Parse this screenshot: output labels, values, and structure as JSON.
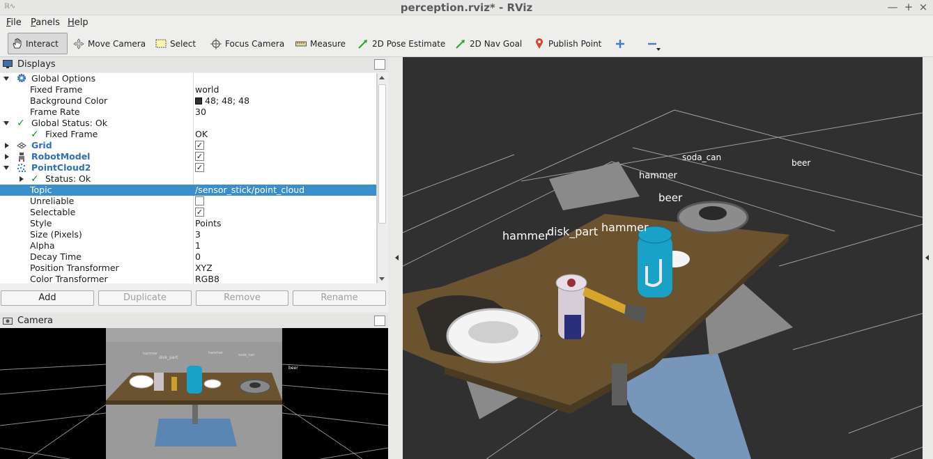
{
  "window": {
    "title": "perception.rviz* - RViz",
    "controls": [
      "—",
      "+",
      "×"
    ]
  },
  "menu": [
    "File",
    "Panels",
    "Help"
  ],
  "toolbar": {
    "interact": "Interact",
    "move_camera": "Move Camera",
    "select": "Select",
    "focus_camera": "Focus Camera",
    "measure": "Measure",
    "pose_estimate": "2D Pose Estimate",
    "nav_goal": "2D Nav Goal",
    "publish_point": "Publish Point"
  },
  "displays": {
    "title": "Displays",
    "rows": {
      "global_options": "Global Options",
      "fixed_frame_label": "Fixed Frame",
      "fixed_frame_value": "world",
      "bg_color_label": "Background Color",
      "bg_color_value": "48; 48; 48",
      "frame_rate_label": "Frame Rate",
      "frame_rate_value": "30",
      "global_status": "Global Status: Ok",
      "gs_fixed_frame_label": "Fixed Frame",
      "gs_fixed_frame_value": "OK",
      "grid": "Grid",
      "robot_model": "RobotModel",
      "point_cloud": "PointCloud2",
      "status": "Status: Ok",
      "topic_label": "Topic",
      "topic_value": "/sensor_stick/point_cloud",
      "unreliable_label": "Unreliable",
      "selectable_label": "Selectable",
      "style_label": "Style",
      "style_value": "Points",
      "size_label": "Size (Pixels)",
      "size_value": "3",
      "alpha_label": "Alpha",
      "alpha_value": "1",
      "decay_label": "Decay Time",
      "decay_value": "0",
      "pos_transformer_label": "Position Transformer",
      "pos_transformer_value": "XYZ",
      "color_transformer_label": "Color Transformer",
      "color_transformer_value": "RGB8"
    },
    "checkbox_mark": "✓",
    "buttons": {
      "add": "Add",
      "duplicate": "Duplicate",
      "remove": "Remove",
      "rename": "Rename"
    }
  },
  "camera": {
    "title": "Camera",
    "labels": [
      "hammer",
      "disk_part",
      "hammer",
      "soda_can",
      "beer"
    ]
  },
  "scene": {
    "labels": {
      "soda_can": "soda_can",
      "beer_far": "beer",
      "hammer_far": "hammer",
      "beer": "beer",
      "hammer_left": "hammer",
      "disk_part": "disk_part",
      "hammer_mid": "hammer"
    },
    "background_color": "#303030",
    "grid_color": "#a0a0a0",
    "table_color": "#6b5330",
    "selection_color": "#3a8ecc"
  }
}
